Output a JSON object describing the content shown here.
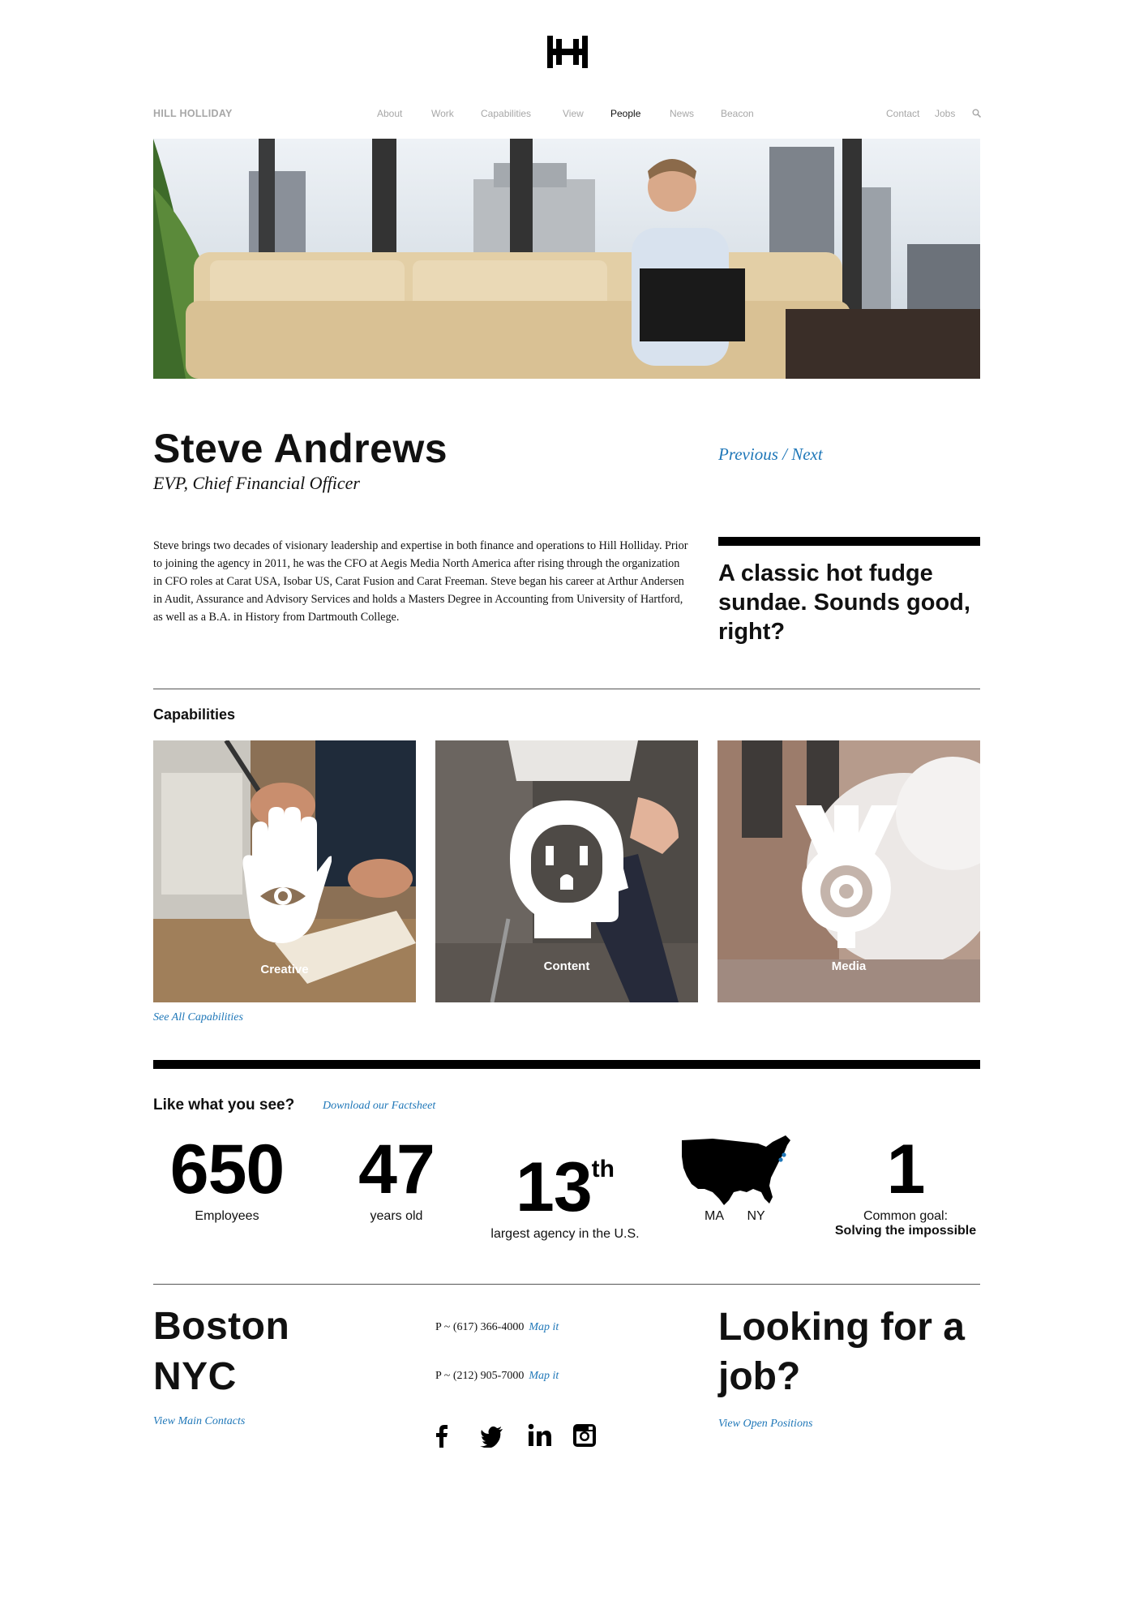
{
  "nav": {
    "brand": "HILL HOLLIDAY",
    "items": [
      "About",
      "Work",
      "Capabilities",
      "View",
      "People",
      "News",
      "Beacon"
    ],
    "active": "People",
    "right_items": [
      "Contact",
      "Jobs"
    ]
  },
  "person": {
    "name": "Steve Andrews",
    "title": "EVP, Chief Financial Officer",
    "prev_label": "Previous",
    "separator": "/",
    "next_label": "Next",
    "bio": "Steve brings two decades of visionary leadership and expertise in both finance and operations to Hill Holliday. Prior to joining the agency in 2011, he was the CFO at Aegis Media North America after rising through the organization in CFO roles at Carat USA, Isobar US, Carat Fusion and Carat Freeman. Steve began his career at Arthur Andersen in Audit, Assurance and Advisory Services and holds a Masters Degree in Accounting from University of Hartford, as well as a B.A. in History from Dartmouth College.",
    "quote": "A classic hot fudge sundae. Sounds good, right?"
  },
  "capabilities": {
    "heading": "Capabilities",
    "tiles": [
      {
        "label": "Creative",
        "icon": "hand-eye-icon"
      },
      {
        "label": "Content",
        "icon": "head-outlet-icon"
      },
      {
        "label": "Media",
        "icon": "target-funnel-icon"
      }
    ],
    "see_all": "See All Capabilities"
  },
  "stats": {
    "heading": "Like what you see?",
    "factsheet": "Download our Factsheet",
    "employees": {
      "num": "650",
      "label": "Employees"
    },
    "years": {
      "num": "47",
      "label": "years old"
    },
    "rank": {
      "num": "13",
      "suffix": "th",
      "label": "largest agency in the U.S."
    },
    "states": {
      "a": "MA",
      "b": "NY"
    },
    "goal": {
      "num": "1",
      "label": "Common goal:",
      "emphasis": "Solving the impossible"
    }
  },
  "footer": {
    "city1": "Boston",
    "city2": "NYC",
    "contacts_link": "View Main Contacts",
    "phone1": "P ~ (617) 366-4000",
    "phone2": "P ~ (212) 905-7000",
    "map_label": "Map it",
    "job_heading": "Looking for a job?",
    "positions_link": "View Open Positions",
    "social": [
      "facebook-icon",
      "twitter-icon",
      "linkedin-icon",
      "instagram-icon"
    ]
  },
  "colors": {
    "accent": "#1f77b8",
    "text": "#111111",
    "nav_inactive": "#a7a7a7"
  }
}
